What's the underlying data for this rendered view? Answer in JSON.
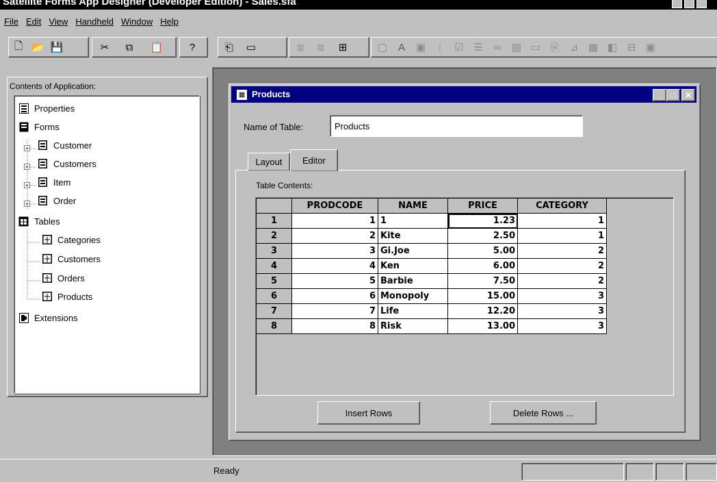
{
  "app": {
    "title": "Satellite Forms App Designer (Developer Edition) - Sales.sfa"
  },
  "menu": [
    "File",
    "Edit",
    "View",
    "Handheld",
    "Window",
    "Help"
  ],
  "left_panel": {
    "label": "Contents of Application:",
    "tree": {
      "properties": "Properties",
      "forms": "Forms",
      "form_items": [
        "Customer",
        "Customers",
        "Item",
        "Order"
      ],
      "tables": "Tables",
      "table_items": [
        "Categories",
        "Customers",
        "Orders",
        "Products"
      ],
      "extensions": "Extensions"
    }
  },
  "child_window": {
    "title": "Products",
    "name_label": "Name of Table:",
    "name_value": "Products",
    "tabs": [
      "Layout",
      "Editor"
    ],
    "active_tab": "Editor",
    "contents_label": "Table Contents:",
    "columns": [
      "PRODCODE",
      "NAME",
      "PRICE",
      "CATEGORY"
    ],
    "rows": [
      {
        "n": "1",
        "prodcode": "1",
        "name": "1",
        "price": "1.23",
        "category": "1"
      },
      {
        "n": "2",
        "prodcode": "2",
        "name": "Kite",
        "price": "2.50",
        "category": "1"
      },
      {
        "n": "3",
        "prodcode": "3",
        "name": "Gi.Joe",
        "price": "5.00",
        "category": "2"
      },
      {
        "n": "4",
        "prodcode": "4",
        "name": "Ken",
        "price": "6.00",
        "category": "2"
      },
      {
        "n": "5",
        "prodcode": "5",
        "name": "Barbie",
        "price": "7.50",
        "category": "2"
      },
      {
        "n": "6",
        "prodcode": "6",
        "name": "Monopoly",
        "price": "15.00",
        "category": "3"
      },
      {
        "n": "7",
        "prodcode": "7",
        "name": "Life",
        "price": "12.20",
        "category": "3"
      },
      {
        "n": "8",
        "prodcode": "8",
        "name": "Risk",
        "price": "13.00",
        "category": "3"
      }
    ],
    "insert_button": "Insert Rows",
    "delete_button": "Delete Rows ..."
  },
  "status": {
    "text": "Ready"
  }
}
